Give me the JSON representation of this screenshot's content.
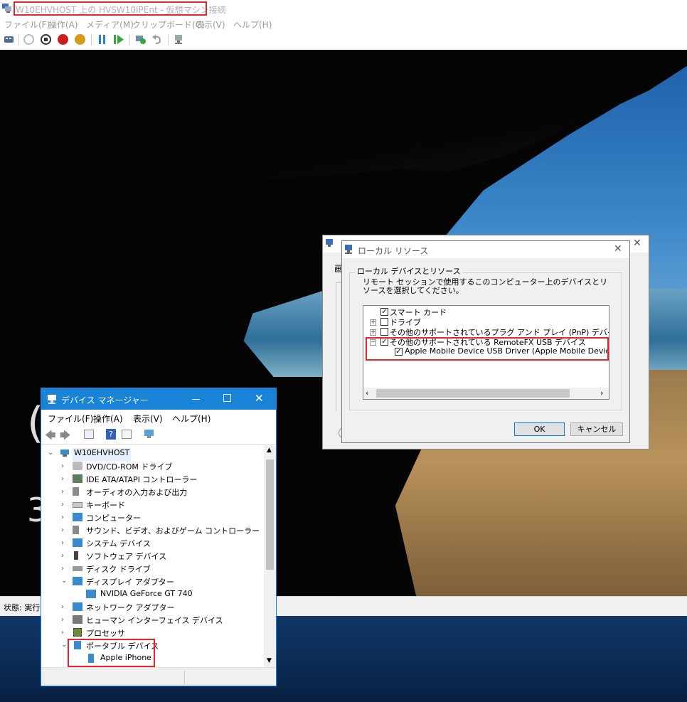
{
  "vm_window": {
    "title": "W10EHVHOST 上の HVSW10IPEnt - 仮想マシン接続",
    "menu": [
      "ファイル(F)",
      "操作(A)",
      "メディア(M)",
      "クリップボード(C)",
      "表示(V)",
      "ヘルプ(H)"
    ],
    "status": "状態: 実行",
    "clock_fragments": [
      "(",
      "",
      "3"
    ]
  },
  "rdp_dialog": {
    "tab_fragment": "画"
  },
  "local_resources": {
    "title": "ローカル リソース",
    "group_label": "ローカル デバイスとリソース",
    "description": "リモート セッションで使用するこのコンピューター上のデバイスとリソースを選択してください。",
    "tree": [
      {
        "label": "スマート カード",
        "checked": true,
        "expander": ""
      },
      {
        "label": "ドライブ",
        "checked": false,
        "expander": "+"
      },
      {
        "label": "その他のサポートされているプラグ アンド プレイ (PnP) デバイス",
        "checked": false,
        "expander": "+"
      },
      {
        "label": "その他のサポートされている RemoteFX USB デバイス",
        "checked": true,
        "expander": "−"
      },
      {
        "label": "Apple Mobile Device USB Driver (Apple Mobile Device",
        "checked": true,
        "expander": ""
      }
    ],
    "ok_label": "OK",
    "cancel_label": "キャンセル"
  },
  "device_manager": {
    "title": "デバイス マネージャー",
    "menu": [
      "ファイル(F)",
      "操作(A)",
      "表示(V)",
      "ヘルプ(H)"
    ],
    "root": "W10EHVHOST",
    "items": [
      {
        "label": "DVD/CD-ROM ドライブ",
        "expanded": false,
        "icon": "dvd-drive-icon"
      },
      {
        "label": "IDE ATA/ATAPI コントローラー",
        "expanded": false,
        "icon": "ide-controller-icon"
      },
      {
        "label": "オーディオの入力および出力",
        "expanded": false,
        "icon": "speaker-icon"
      },
      {
        "label": "キーボード",
        "expanded": false,
        "icon": "keyboard-icon"
      },
      {
        "label": "コンピューター",
        "expanded": false,
        "icon": "computer-icon"
      },
      {
        "label": "サウンド、ビデオ、およびゲーム コントローラー",
        "expanded": false,
        "icon": "speaker-icon"
      },
      {
        "label": "システム デバイス",
        "expanded": false,
        "icon": "system-device-icon"
      },
      {
        "label": "ソフトウェア デバイス",
        "expanded": false,
        "icon": "software-device-icon"
      },
      {
        "label": "ディスク ドライブ",
        "expanded": false,
        "icon": "disk-drive-icon"
      },
      {
        "label": "ディスプレイ アダプター",
        "expanded": true,
        "icon": "display-adapter-icon"
      },
      {
        "label": "NVIDIA GeForce GT 740",
        "child": true,
        "icon": "display-adapter-icon"
      },
      {
        "label": "ネットワーク アダプター",
        "expanded": false,
        "icon": "network-adapter-icon"
      },
      {
        "label": "ヒューマン インターフェイス デバイス",
        "expanded": false,
        "icon": "hid-icon"
      },
      {
        "label": "プロセッサ",
        "expanded": false,
        "icon": "processor-icon"
      },
      {
        "label": "ポータブル デバイス",
        "expanded": true,
        "icon": "portable-device-icon"
      },
      {
        "label": "Apple iPhone",
        "child": true,
        "icon": "phone-icon"
      }
    ]
  },
  "colors": {
    "highlight": "#e0282c",
    "accent": "#1883d7"
  }
}
